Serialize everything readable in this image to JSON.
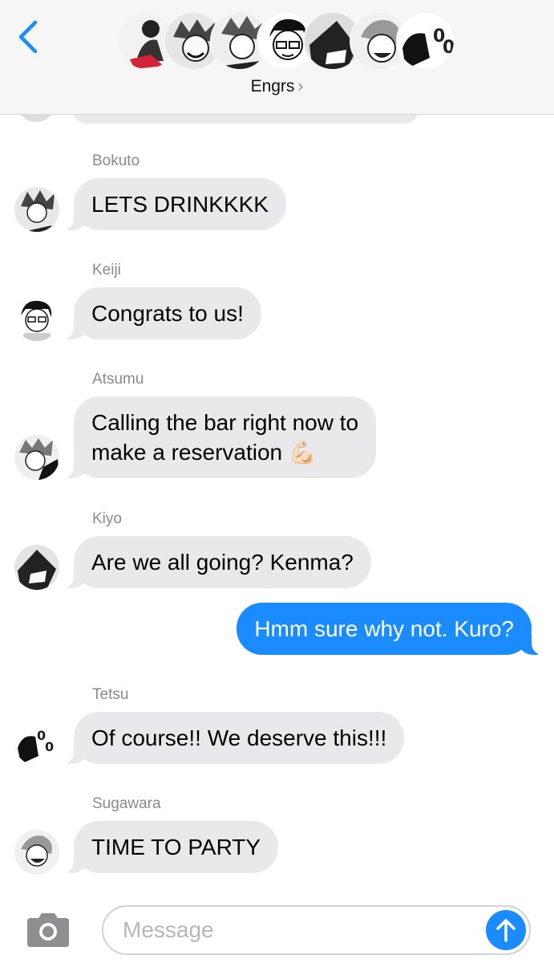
{
  "header": {
    "back_label": "Back",
    "group_title": "Engrs",
    "chevron": "›",
    "avatars": [
      "member-1",
      "member-2",
      "member-3",
      "member-4",
      "member-5",
      "member-6",
      "member-7"
    ]
  },
  "messages": [
    {
      "sender": "Bokuto",
      "text": "LETS DRINKKKK",
      "direction": "received"
    },
    {
      "sender": "Keiji",
      "text": "Congrats to us!",
      "direction": "received"
    },
    {
      "sender": "Atsumu",
      "text_line1": "Calling the bar right now to",
      "text_line2": "make a reservation 💪🏻",
      "direction": "received"
    },
    {
      "sender": "Kiyo",
      "text": "Are we all going? Kenma?",
      "direction": "received"
    },
    {
      "text": "Hmm sure why not. Kuro?",
      "direction": "sent"
    },
    {
      "sender": "Tetsu",
      "text": "Of course!! We deserve this!!!",
      "direction": "received"
    },
    {
      "sender": "Sugawara",
      "text": "TIME TO PARTY",
      "direction": "received"
    }
  ],
  "composer": {
    "placeholder": "Message",
    "camera_icon": "camera-icon",
    "send_icon": "arrow-up-icon"
  },
  "colors": {
    "accent": "#1a8cff",
    "received_bubble": "#e9e9eb",
    "header_bg": "#f6f6f6",
    "sender_text": "#8a8a8e"
  }
}
